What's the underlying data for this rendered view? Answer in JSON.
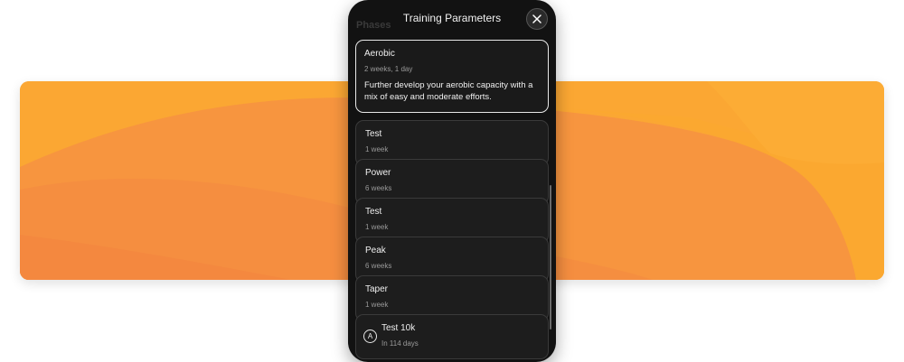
{
  "sheet": {
    "title": "Training Parameters",
    "background_label": "Phases",
    "close_icon": "close-icon"
  },
  "phases": [
    {
      "name": "Aerobic",
      "duration": "2 weeks, 1 day",
      "description": "Further develop your aerobic capacity with a mix of easy and moderate efforts.",
      "selected": true
    },
    {
      "name": "Test",
      "duration": "1 week"
    },
    {
      "name": "Power",
      "duration": "6 weeks"
    },
    {
      "name": "Test",
      "duration": "1 week"
    },
    {
      "name": "Peak",
      "duration": "6 weeks"
    },
    {
      "name": "Taper",
      "duration": "1 week"
    }
  ],
  "goal": {
    "badge": "A",
    "name": "Test 10k",
    "timing": "In 114 days"
  },
  "colors": {
    "accent_orange": "#f99a3a",
    "sheet_background": "#121212",
    "card_background": "#1d1d1d"
  }
}
